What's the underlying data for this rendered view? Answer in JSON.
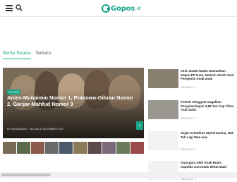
{
  "header": {
    "logo_text": "Gopos",
    "logo_tld": ".id"
  },
  "tabs": [
    {
      "label": "Berita Teratas"
    },
    {
      "label": "Terbaru"
    }
  ],
  "hero": {
    "category": "POLITIK",
    "title": "Anies-Muhaimin Nomor 1, Prabowo-Gibran Nomor 2, Ganjar-Mahfud Nomor 3",
    "meta": "BY HASANUDDIN · SELASA 14 NOVEMBER 2023",
    "next_label": "›"
  },
  "sidebar": [
    {
      "title": "Viral, Badut-badut Diamankan Satpol PP Kota, Netizen Sindir Soal Pengemis Anak-anak",
      "meta": "2023/11/13 · 1"
    },
    {
      "title": "Polsek Atinggola Gagalkan Penyelundupan 3,88 Ton Cap Tikus Asal Sulut",
      "meta": "2023/11/13 · 1"
    },
    {
      "title": "Sejak Kehadiran MyPertamina, Hak Tak Lagi Was-was",
      "meta": "2023/11/13 · 1"
    },
    {
      "title": "Gara-gara Ulah Anak Buah, Kapolda Gorontalo Minta Maaf",
      "meta": "2023/11/13 · 1"
    }
  ],
  "colors": {
    "accent": "#1aa58a"
  }
}
